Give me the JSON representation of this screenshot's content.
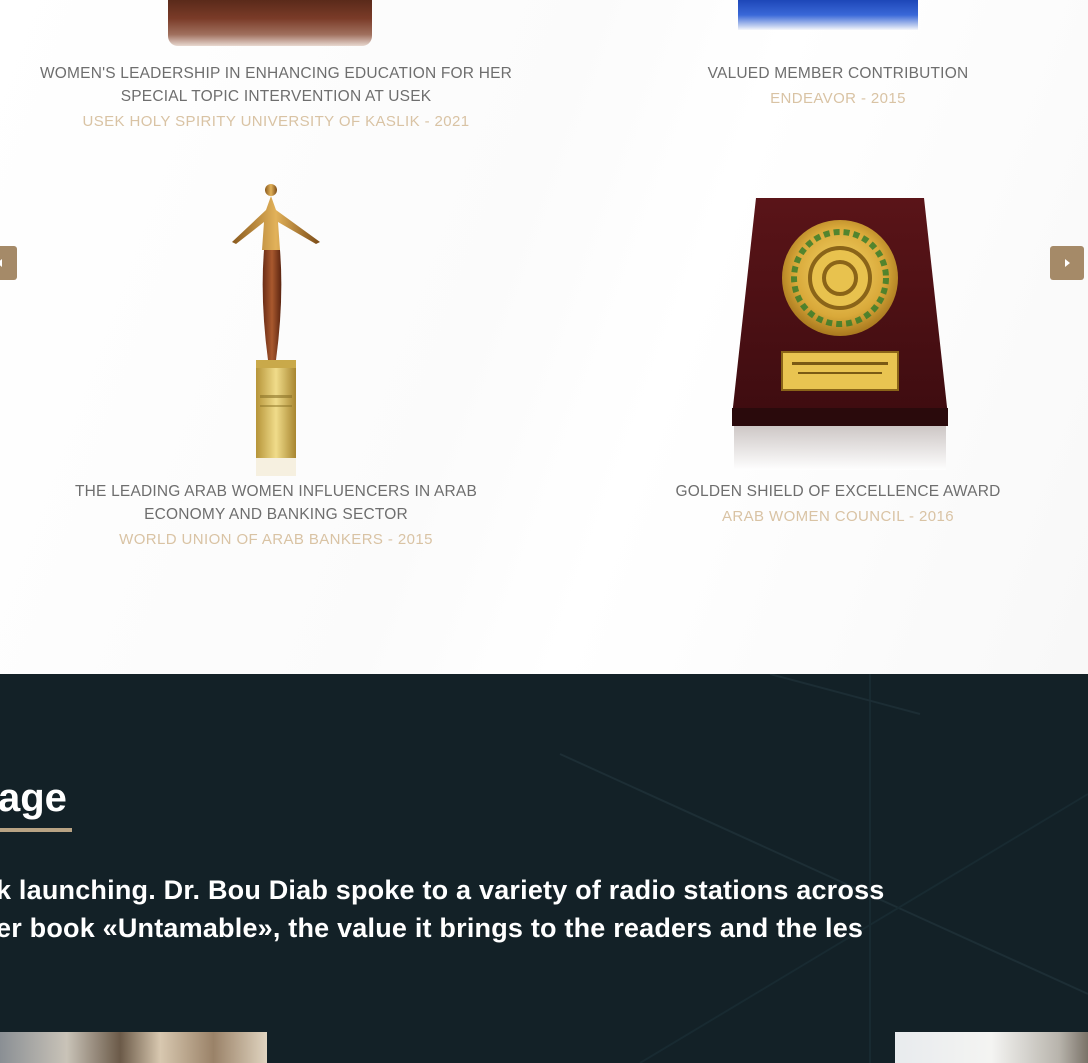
{
  "awards": [
    {
      "title_lines": [
        "WOMEN'S LEADERSHIP IN ENHANCING EDUCATION FOR HER",
        "SPECIAL TOPIC INTERVENTION AT USEK"
      ],
      "org": "USEK HOLY SPIRITY UNIVERSITY OF KASLIK - 2021"
    },
    {
      "title_lines": [
        "VALUED MEMBER CONTRIBUTION"
      ],
      "org": "ENDEAVOR - 2015"
    },
    {
      "title_lines": [
        "THE LEADING ARAB WOMEN INFLUENCERS IN ARAB",
        "ECONOMY AND BANKING SECTOR"
      ],
      "org": "WORLD UNION OF ARAB BANKERS - 2015"
    },
    {
      "title_lines": [
        "GOLDEN SHIELD OF EXCELLENCE AWARD"
      ],
      "org": "ARAB WOMEN COUNCIL - 2016"
    }
  ],
  "carousel": {
    "prev_icon": "chevron-left-icon",
    "next_icon": "chevron-right-icon",
    "arrow_color": "#a58a68"
  },
  "media": {
    "title": "age",
    "lines": [
      "k launching. Dr. Bou Diab spoke to a variety of radio stations across",
      "er book «Untamable», the value it brings to the readers and the les"
    ],
    "background": "#132127",
    "accent": "#b8a384"
  }
}
